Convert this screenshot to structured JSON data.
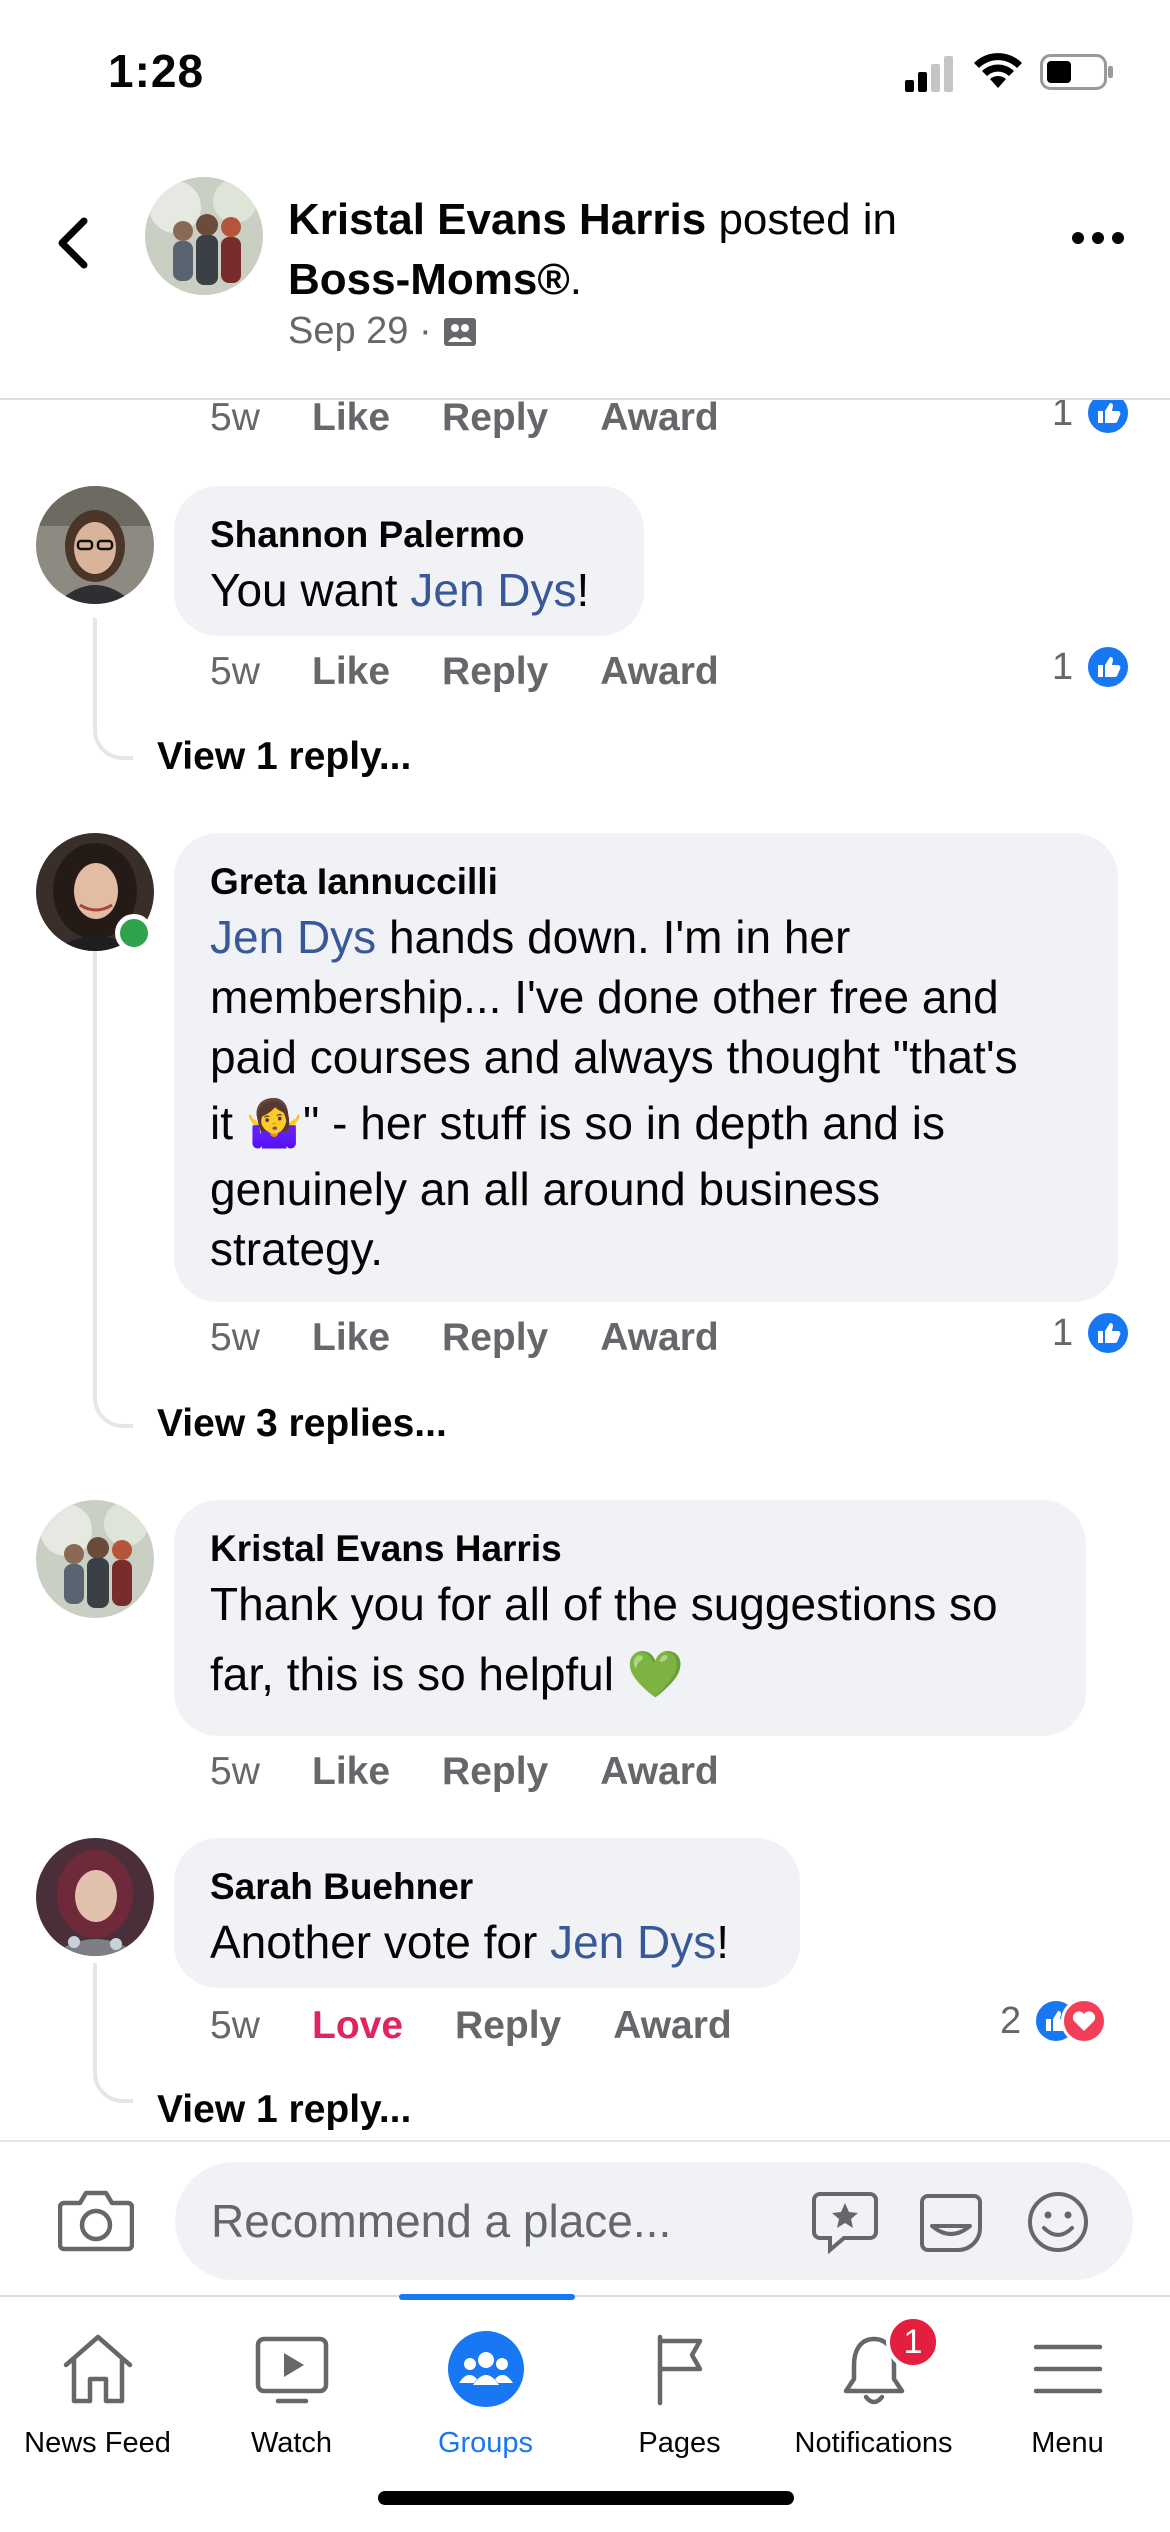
{
  "status_bar": {
    "time": "1:28"
  },
  "post": {
    "author": "Kristal Evans Harris",
    "posted_in_text": " posted in",
    "group": "Boss-Moms®",
    "group_suffix": ".",
    "date": "Sep 29 ·"
  },
  "top_action_row": {
    "time": "5w",
    "like": "Like",
    "reply": "Reply",
    "award": "Award",
    "reaction_count": "1"
  },
  "comments": [
    {
      "name": "Shannon Palermo",
      "text_before": "You want ",
      "mention": "Jen Dys",
      "text_after": "!",
      "time": "5w",
      "like": "Like",
      "reply": "Reply",
      "award": "Award",
      "reaction_count": "1",
      "view_replies": "View 1 reply..."
    },
    {
      "name": "Greta Iannuccilli",
      "mention": "Jen Dys",
      "line1_after": " hands down. I'm in her",
      "line2": "membership... I've done other free and",
      "line3": "paid courses and always thought \"that's",
      "line4": "it 🤷‍♀️\" - her stuff is so in depth and is",
      "line5": "genuinely an all around business",
      "line6": "strategy.",
      "time": "5w",
      "like": "Like",
      "reply": "Reply",
      "award": "Award",
      "reaction_count": "1",
      "view_replies": "View 3 replies..."
    },
    {
      "name": "Kristal Evans Harris",
      "line1": "Thank you for all of the suggestions so",
      "line2": "far, this is so helpful 💚",
      "time": "5w",
      "like": "Like",
      "reply": "Reply",
      "award": "Award"
    },
    {
      "name": "Sarah Buehner",
      "text_before": "Another vote for ",
      "mention": "Jen Dys",
      "text_after": "!",
      "time": "5w",
      "love": "Love",
      "reply": "Reply",
      "award": "Award",
      "reaction_count": "2",
      "view_replies": "View 1 reply..."
    }
  ],
  "composer": {
    "placeholder": "Recommend a place..."
  },
  "bottom_nav": {
    "items": [
      {
        "label": "News Feed",
        "icon": "home-icon"
      },
      {
        "label": "Watch",
        "icon": "video-play-icon"
      },
      {
        "label": "Groups",
        "icon": "groups-icon",
        "active": true
      },
      {
        "label": "Pages",
        "icon": "flag-icon"
      },
      {
        "label": "Notifications",
        "icon": "bell-icon",
        "badge": "1"
      },
      {
        "label": "Menu",
        "icon": "hamburger-menu-icon"
      }
    ]
  },
  "colors": {
    "accent": "#1877f2",
    "mention": "#385898",
    "love": "#e0245e",
    "bubble": "#f0f2f5",
    "online": "#31a24c"
  }
}
